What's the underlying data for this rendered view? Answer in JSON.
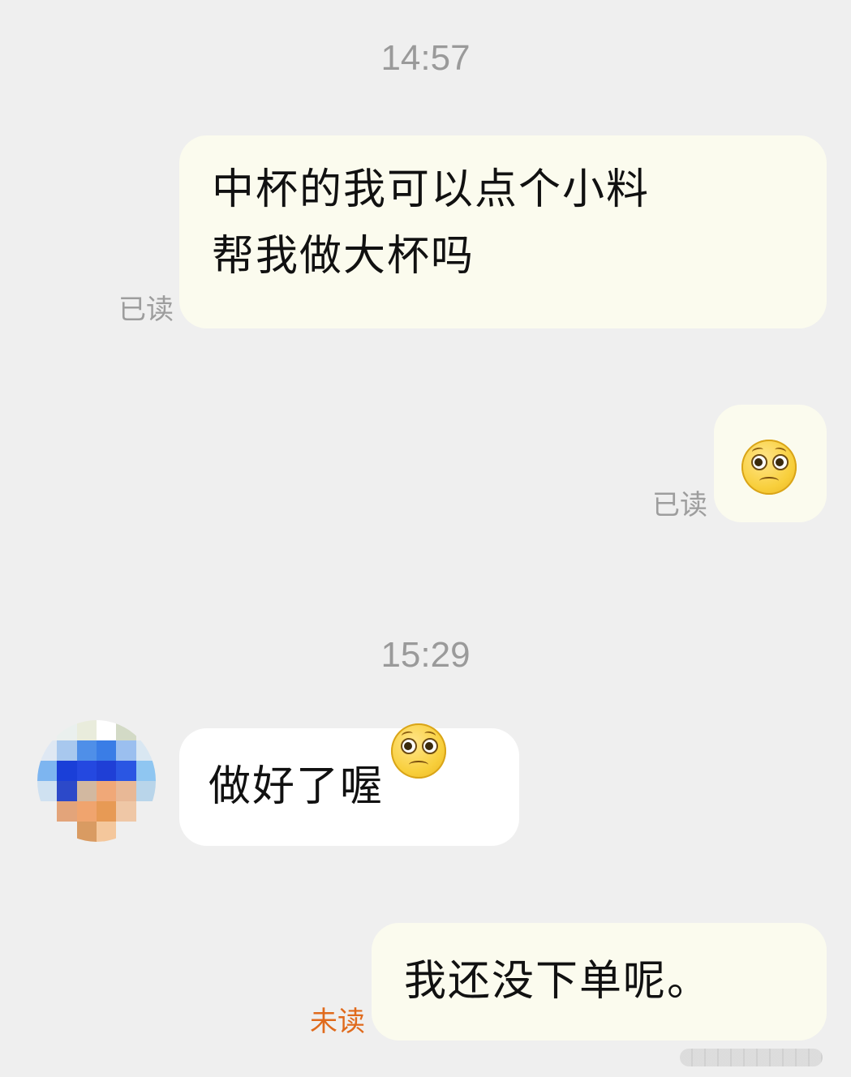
{
  "chat": {
    "timestamps": [
      "14:57",
      "15:29"
    ],
    "messages": [
      {
        "sender": "me",
        "lines": [
          "中杯的我可以点个小料",
          "帮我做大杯吗"
        ],
        "status": "已读"
      },
      {
        "sender": "me",
        "emoji": "worried-face-emoji",
        "status": "已读"
      },
      {
        "sender": "other",
        "text": "做好了喔",
        "emoji": "worried-face-emoji"
      },
      {
        "sender": "me",
        "text": "我还没下单呢。",
        "status": "未读"
      }
    ]
  },
  "colors": {
    "background": "#efefef",
    "outgoing_bubble": "#fbfbee",
    "incoming_bubble": "#ffffff",
    "timestamp": "#9a9a9a",
    "read_status": "#9d9d9d",
    "unread_status": "#e06a1c"
  },
  "avatar": {
    "pixel_colors": [
      "#efefef",
      "#eaf0ee",
      "#e9ecdc",
      "#ffffff",
      "#d3dac6",
      "#efefef",
      "#dfe8f3",
      "#a8c8ee",
      "#4f8fe8",
      "#3a7de6",
      "#9bbfef",
      "#d9e7f2",
      "#7db5f0",
      "#1a3fd8",
      "#2448e0",
      "#1f3fd6",
      "#2a56e3",
      "#8fc6f1",
      "#cfe1f1",
      "#2c49c9",
      "#d2b8a0",
      "#f0a878",
      "#e8b896",
      "#b9d5ea",
      "#efefef",
      "#e3a47a",
      "#f0a46e",
      "#e79a55",
      "#efc7a6",
      "#efefef",
      "#efefef",
      "#efefef",
      "#d99b62",
      "#f4c79c",
      "#efefef",
      "#efefef"
    ]
  }
}
